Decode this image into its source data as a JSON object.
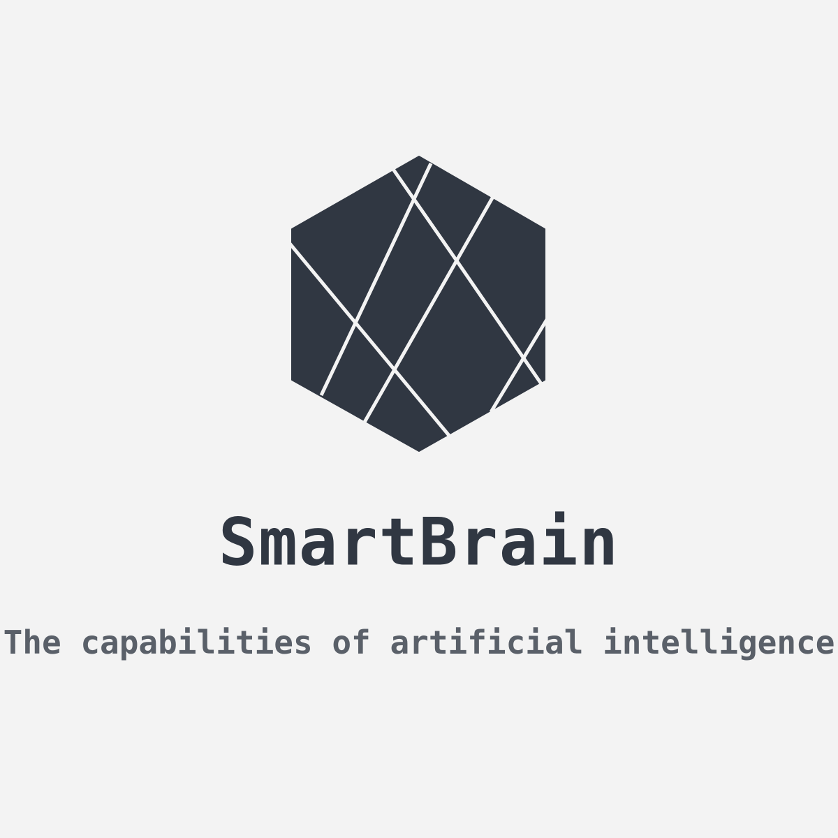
{
  "brand": {
    "name": "SmartBrain",
    "tagline": "The capabilities of artificial intelligence"
  },
  "logo": {
    "icon": "faceted-hexagon-brain-icon",
    "fill_color": "#303742",
    "line_color": "#f3f3f3"
  },
  "colors": {
    "background": "#f3f3f3",
    "title": "#303742",
    "subtitle": "#5a6069"
  }
}
